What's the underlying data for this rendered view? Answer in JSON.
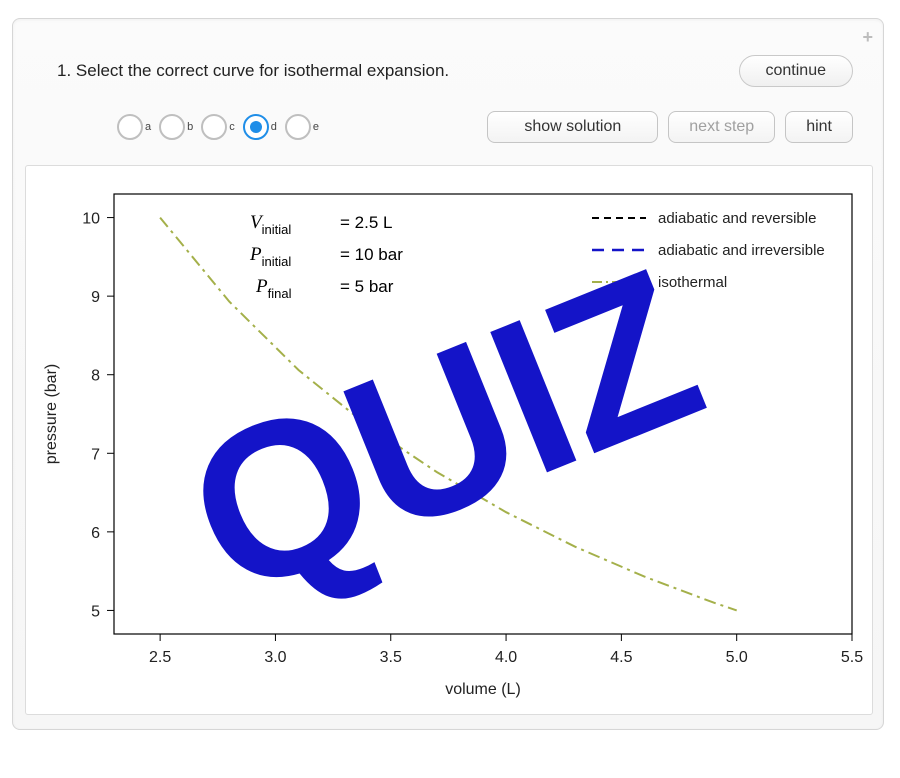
{
  "header": {
    "question": "1. Select the correct curve for isothermal expansion.",
    "continue": "continue"
  },
  "icons": {
    "plus": "+"
  },
  "radios": {
    "options": [
      "a",
      "b",
      "c",
      "d",
      "e"
    ],
    "selected": "d"
  },
  "buttons": {
    "show_solution": "show solution",
    "next_step": "next step",
    "hint": "hint"
  },
  "info": {
    "v_label_var": "V",
    "v_label_sub": "initial",
    "v_value": "= 2.5 L",
    "p1_label_var": "P",
    "p1_label_sub": "initial",
    "p1_value": "= 10 bar",
    "p2_label_var": "P",
    "p2_label_sub": "final",
    "p2_value": "= 5 bar"
  },
  "legend": {
    "l1": "adiabatic and reversible",
    "l2": "adiabatic and irreversible",
    "l3": "isothermal"
  },
  "axes": {
    "xlabel": "volume (L)",
    "ylabel": "pressure (bar)",
    "xticks": [
      "2.5",
      "3.0",
      "3.5",
      "4.0",
      "4.5",
      "5.0",
      "5.5"
    ],
    "yticks": [
      "5",
      "6",
      "7",
      "8",
      "9",
      "10"
    ]
  },
  "overlay": {
    "text": "QUIZ"
  },
  "chart_data": {
    "type": "line",
    "title": "",
    "xlabel": "volume (L)",
    "ylabel": "pressure (bar)",
    "xlim": [
      2.3,
      5.5
    ],
    "ylim": [
      4.7,
      10.3
    ],
    "series": [
      {
        "name": "isothermal",
        "style": "dash-dot",
        "color": "#a4b04a",
        "equation": "P = 25 / V",
        "x": [
          2.5,
          2.8,
          3.1,
          3.4,
          3.7,
          4.0,
          4.3,
          4.6,
          4.9,
          5.0
        ],
        "y": [
          10.0,
          8.93,
          8.06,
          7.35,
          6.76,
          6.25,
          5.81,
          5.43,
          5.1,
          5.0
        ]
      }
    ],
    "annotations": [
      {
        "text": "V_initial = 2.5 L"
      },
      {
        "text": "P_initial = 10 bar"
      },
      {
        "text": "P_final = 5 bar"
      }
    ],
    "legend_entries": [
      {
        "name": "adiabatic and reversible",
        "style": "short-dash",
        "color": "#000000"
      },
      {
        "name": "adiabatic and irreversible",
        "style": "long-dash",
        "color": "#1414c8"
      },
      {
        "name": "isothermal",
        "style": "dash-dot",
        "color": "#a4b04a"
      }
    ]
  }
}
